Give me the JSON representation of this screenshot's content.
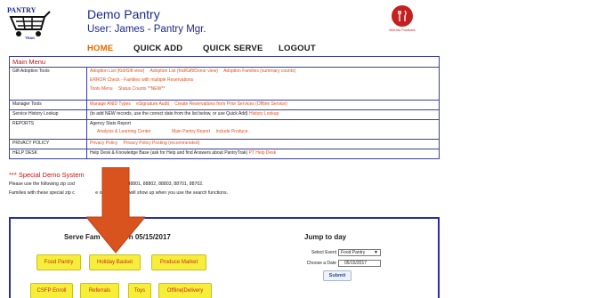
{
  "header": {
    "logo_text": "PANTRY TRAK",
    "title": "Demo Pantry",
    "user_line": "User: James - Pantry Mgr.",
    "nav": {
      "home": "HOME",
      "quick_add": "QUICK ADD",
      "quick_serve": "QUICK SERVE",
      "logout": "LOGOUT"
    },
    "partner_name": "MidOhio Foodbank"
  },
  "menu": {
    "title": "Main Menu",
    "rows": [
      {
        "label": "Gift Adoption Tools",
        "line1": [
          "Adoption List (Kid/Gift view)",
          "Adoption List (Kid/Gift/Donor view)",
          "Adoption Families (summary counts)"
        ],
        "line2": [
          "ERROR Check - Families with multiple Reservations"
        ],
        "line3": [
          "Tools Menu",
          "Status Counts **NEW**"
        ]
      },
      {
        "label": "Manager Tools",
        "links": [
          "Manage ANID Types",
          "eSignature Audit",
          "Create Reservations from Prior Services (Offline Service)"
        ]
      },
      {
        "label": "Service History Lookup",
        "text": "(to add NEW records, use the correct date from the list below, or use Quick Add)",
        "link": "History Lookup"
      },
      {
        "label": "REPORTS",
        "text": "Agency Stats Report",
        "links": [
          "Analysis & Learning Center",
          "Main Pantry Report",
          "Include Produce"
        ]
      },
      {
        "label": "PRIVACY POLICY",
        "links": [
          "Privacy Policy",
          "Privacy Policy Posting (recommended)"
        ]
      },
      {
        "label": "HELP DESK",
        "text": "Help Desk & Knowledge Base (ask for Help and find Answers about PantryTrak)",
        "link": "PT Help Desk"
      }
    ]
  },
  "notice": {
    "title": "*** Special Demo System",
    "title_tail": "***",
    "line1_a": "Please use the following zip cod",
    "line1_b": "entries - 88801, 88802, 88803, 88701, 88702.",
    "line2_a": "Families with these special zip c",
    "line2_b": "e only ones that will show up when you use the search functions."
  },
  "serve": {
    "title_a": "Serve Fam",
    "title_b": "n 05/15/2017",
    "buttons_row1": [
      "Food Pantry",
      "Holiday Basket",
      "Produce Market"
    ],
    "buttons_row2": [
      "CSFP Enroll",
      "Referrals",
      "Toys",
      "Offline|Delivery"
    ]
  },
  "jump": {
    "title": "Jump to day",
    "event_label": "Select Event",
    "event_value": "Food Pantry",
    "date_label": "Choose a Date",
    "date_value": "05/15/2017",
    "submit": "Submit"
  },
  "colors": {
    "navy": "#1b2a8a",
    "link_orange": "#e05020",
    "alert_red": "#d01010",
    "button_yellow": "#f6ee3a",
    "arrow_red": "#d9531e"
  }
}
